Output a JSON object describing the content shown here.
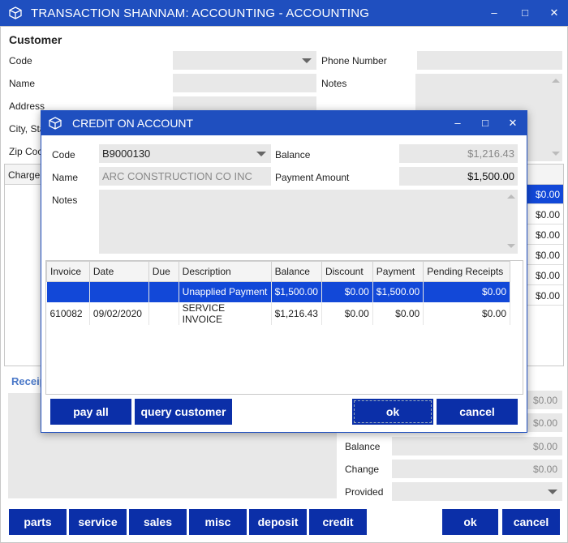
{
  "window": {
    "title": "TRANSACTION SHANNAM: ACCOUNTING  - ACCOUNTING",
    "minimize": "–",
    "maximize": "□",
    "close": "✕"
  },
  "customer": {
    "heading": "Customer",
    "code_label": "Code",
    "name_label": "Name",
    "address_label": "Address",
    "city_label": "City, Sta",
    "zip_label": "Zip Coc",
    "phone_label": "Phone Number",
    "notes_label": "Notes",
    "charge_header": "Charge"
  },
  "right_grid_values": [
    "$0.00",
    "$0.00",
    "$0.00",
    "$0.00",
    "$0.00",
    "$0.00"
  ],
  "receipts": {
    "label": "Receip",
    "amount1": "$0.00",
    "amount2": "$0.00",
    "balance_label": "Balance",
    "balance_value": "$0.00",
    "change_label": "Change",
    "change_value": "$0.00",
    "provided_label": "Provided"
  },
  "bottom_buttons": {
    "parts": "parts",
    "service": "service",
    "sales": "sales",
    "misc": "misc",
    "deposit": "deposit",
    "credit": "credit",
    "ok": "ok",
    "cancel": "cancel"
  },
  "dialog": {
    "title": "CREDIT ON ACCOUNT",
    "code_label": "Code",
    "code_value": "B9000130",
    "name_label": "Name",
    "name_value": "ARC CONSTRUCTION CO INC",
    "notes_label": "Notes",
    "balance_label": "Balance",
    "balance_value": "$1,216.43",
    "payment_label": "Payment Amount",
    "payment_value": "$1,500.00",
    "columns": [
      "Invoice",
      "Date",
      "Due",
      "Description",
      "Balance",
      "Discount",
      "Payment",
      "Pending Receipts"
    ],
    "rows": [
      {
        "invoice": "",
        "date": "",
        "due": "",
        "description": "Unapplied Payment",
        "balance": "$1,500.00",
        "discount": "$0.00",
        "payment": "$1,500.00",
        "pending": "$0.00",
        "selected": true
      },
      {
        "invoice": "610082",
        "date": "09/02/2020",
        "due": "",
        "description": "SERVICE INVOICE",
        "balance": "$1,216.43",
        "discount": "$0.00",
        "payment": "$0.00",
        "pending": "$0.00",
        "selected": false
      }
    ],
    "buttons": {
      "pay_all": "pay all",
      "query_customer": "query customer",
      "ok": "ok",
      "cancel": "cancel"
    }
  }
}
